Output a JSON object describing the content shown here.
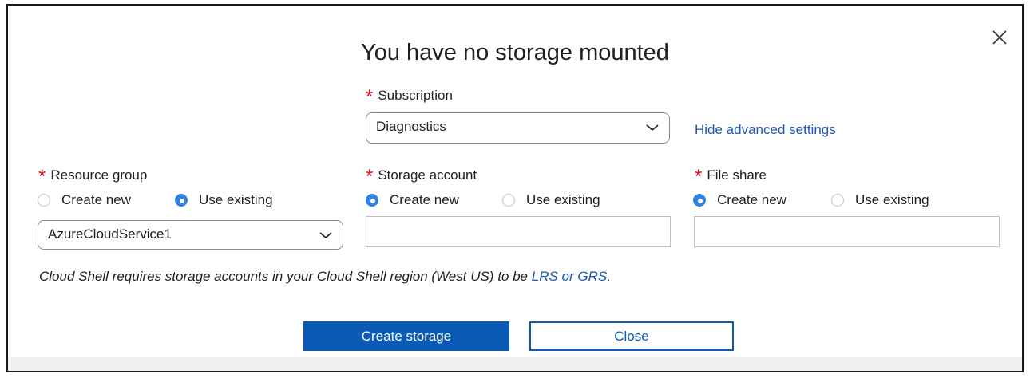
{
  "dialog": {
    "title": "You have no storage mounted",
    "close_icon": "close-icon"
  },
  "subscription": {
    "label": "Subscription",
    "value": "Diagnostics",
    "advanced_link": "Hide advanced settings"
  },
  "resource_group": {
    "label": "Resource group",
    "options": [
      "Create new",
      "Use existing"
    ],
    "selected": "Use existing",
    "value": "AzureCloudService1"
  },
  "storage_account": {
    "label": "Storage account",
    "options": [
      "Create new",
      "Use existing"
    ],
    "selected": "Create new",
    "value": ""
  },
  "file_share": {
    "label": "File share",
    "options": [
      "Create new",
      "Use existing"
    ],
    "selected": "Create new",
    "value": ""
  },
  "note": {
    "text": "Cloud Shell requires storage accounts in your Cloud Shell region (West US) to be ",
    "link": "LRS or GRS",
    "suffix": "."
  },
  "buttons": {
    "create": "Create storage",
    "close": "Close"
  },
  "colors": {
    "accent": "#0b5bb4",
    "link": "#1b56b6",
    "required": "#e00b1c",
    "radio_selected": "#2d82e6"
  }
}
